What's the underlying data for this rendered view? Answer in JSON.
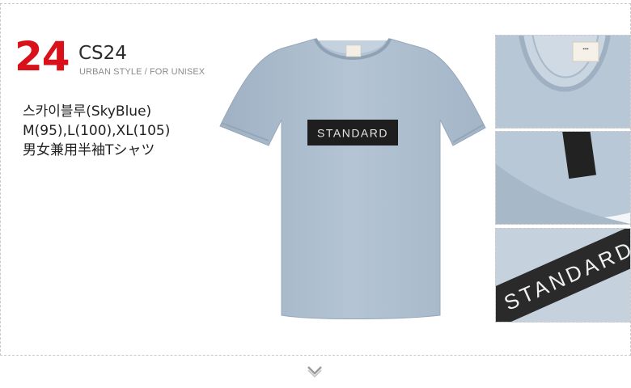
{
  "product": {
    "number": "24",
    "code": "CS24",
    "style_line": "URBAN STYLE / FOR UNISEX",
    "color_line": "스카이블루(SkyBlue)",
    "sizes_line": "M(95),L(100),XL(105)",
    "jp_line": "男女兼用半袖Tシャツ",
    "print_text": "STANDARD"
  },
  "colors": {
    "accent": "#d8111a",
    "shirt": "#aebfd0",
    "print_box": "#1e1e1e"
  },
  "icons": {
    "scroll": "chevron-down-icon"
  }
}
